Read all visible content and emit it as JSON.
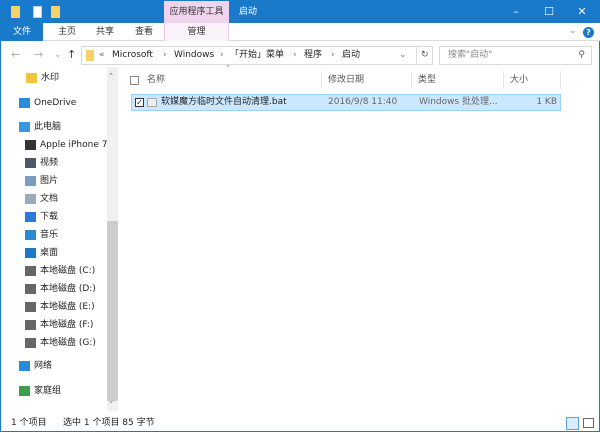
{
  "window": {
    "title": "启动",
    "context_tab_group": "应用程序工具",
    "minimize": "–",
    "maximize": "☐",
    "close": "✕"
  },
  "ribbon": {
    "tabs": [
      {
        "label": "文件"
      },
      {
        "label": "主页"
      },
      {
        "label": "共享"
      },
      {
        "label": "查看"
      },
      {
        "label": "管理"
      }
    ],
    "expand": "⌄",
    "help": "?"
  },
  "nav": {
    "back": "←",
    "forward": "→",
    "recent": "⌄",
    "up": "↑"
  },
  "address": {
    "overflow": "«",
    "crumbs": [
      "Microsoft",
      "Windows",
      "「开始」菜单",
      "程序",
      "启动"
    ],
    "sep": "›",
    "dropdown": "⌄",
    "refresh": "↻"
  },
  "search": {
    "placeholder": "搜索\"启动\"",
    "icon": "search-icon"
  },
  "sidebar": {
    "items": [
      {
        "label": "水印",
        "icon": "folder-icon",
        "color": "#f5c342"
      },
      {
        "label": "OneDrive",
        "icon": "onedrive-icon",
        "color": "#2b8cdb"
      },
      {
        "label": "此电脑",
        "icon": "computer-icon",
        "color": "#3a96dd"
      },
      {
        "label": "Apple iPhone 7",
        "icon": "phone-icon",
        "color": "#333333"
      },
      {
        "label": "视频",
        "icon": "video-icon",
        "color": "#4a5a6a"
      },
      {
        "label": "图片",
        "icon": "pictures-icon",
        "color": "#7a9cc0"
      },
      {
        "label": "文档",
        "icon": "documents-icon",
        "color": "#9ab"
      },
      {
        "label": "下载",
        "icon": "download-icon",
        "color": "#2a7ad6"
      },
      {
        "label": "音乐",
        "icon": "music-icon",
        "color": "#2a8ad6"
      },
      {
        "label": "桌面",
        "icon": "desktop-icon",
        "color": "#1e78c8"
      },
      {
        "label": "本地磁盘 (C:)",
        "icon": "drive-icon",
        "color": "#666666"
      },
      {
        "label": "本地磁盘 (D:)",
        "icon": "drive-icon",
        "color": "#666666"
      },
      {
        "label": "本地磁盘 (E:)",
        "icon": "drive-icon",
        "color": "#666666"
      },
      {
        "label": "本地磁盘 (F:)",
        "icon": "drive-icon",
        "color": "#666666"
      },
      {
        "label": "本地磁盘 (G:)",
        "icon": "drive-icon",
        "color": "#666666"
      },
      {
        "label": "网络",
        "icon": "network-icon",
        "color": "#2a8ad6"
      },
      {
        "label": "家庭组",
        "icon": "homegroup-icon",
        "color": "#3aa04a"
      }
    ],
    "scroll_up": "˄",
    "scroll_down": "˅"
  },
  "columns": {
    "sort_indicator": "˄",
    "name": "名称",
    "date": "修改日期",
    "type": "类型",
    "size": "大小"
  },
  "files": [
    {
      "name": "软媒魔方临时文件自动清理.bat",
      "date": "2016/9/8 11:40",
      "type": "Windows 批处理...",
      "size": "1 KB",
      "selected": true
    }
  ],
  "status": {
    "count": "1 个项目",
    "selected": "选中 1 个项目  85 字节"
  },
  "colors": {
    "accent": "#1979ca",
    "context": "#f0d3ef",
    "selection": "#cce8ff"
  }
}
